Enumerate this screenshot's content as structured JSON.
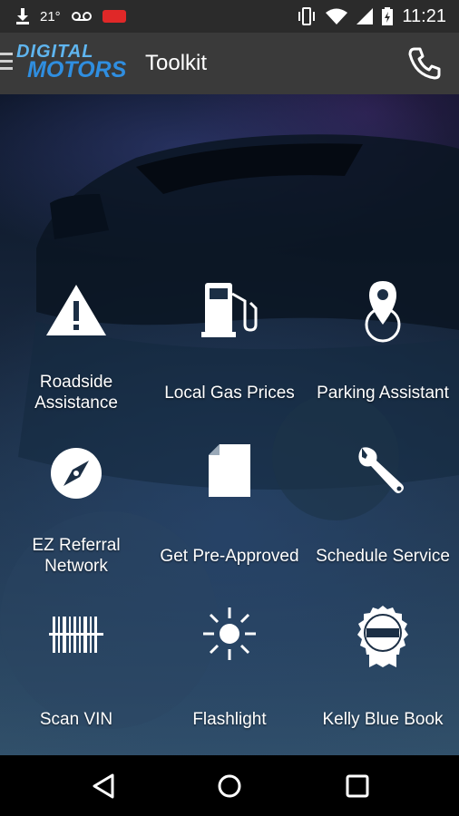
{
  "status_bar": {
    "temperature": "21°",
    "time": "11:21"
  },
  "app_bar": {
    "logo_line1": "DIGITAL",
    "logo_line2": "MOTORS",
    "title": "Toolkit"
  },
  "tools": [
    {
      "label": "Roadside\nAssistance",
      "icon": "warning-icon"
    },
    {
      "label": "Local Gas Prices",
      "icon": "gas-pump-icon"
    },
    {
      "label": "Parking Assistant",
      "icon": "map-pin-icon"
    },
    {
      "label": "EZ Referral\nNetwork",
      "icon": "compass-icon"
    },
    {
      "label": "Get Pre-Approved",
      "icon": "document-icon"
    },
    {
      "label": "Schedule Service",
      "icon": "wrench-icon"
    },
    {
      "label": "Scan VIN",
      "icon": "barcode-icon"
    },
    {
      "label": "Flashlight",
      "icon": "sun-icon"
    },
    {
      "label": "Kelly Blue Book",
      "icon": "kbb-badge-icon"
    }
  ]
}
